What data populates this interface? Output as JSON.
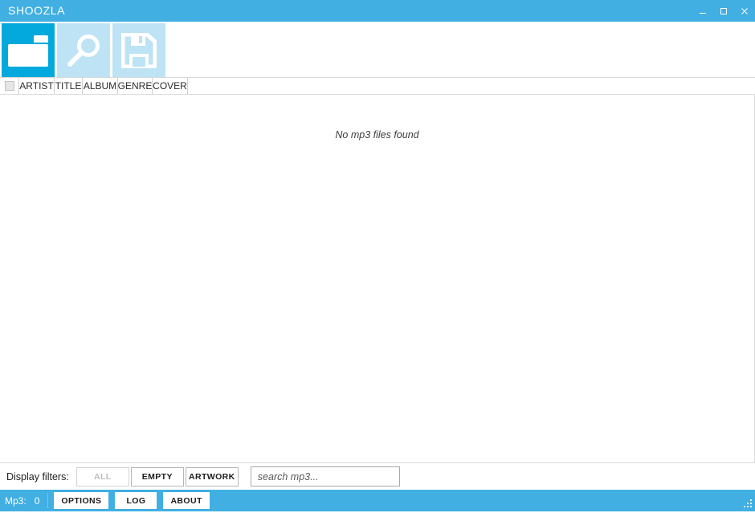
{
  "window": {
    "title": "SHOOZLA",
    "controls": {
      "minimize": "minimize",
      "maximize": "maximize",
      "close": "close"
    },
    "accent_color": "#41afe2",
    "toolbar_active_color": "#03a9dc",
    "toolbar_idle_color": "#bde3f5"
  },
  "toolbar": {
    "buttons": [
      {
        "name": "open-folder",
        "icon": "folder-icon",
        "state": "active"
      },
      {
        "name": "search",
        "icon": "magnifier-icon",
        "state": "idle"
      },
      {
        "name": "save",
        "icon": "floppy-disk-icon",
        "state": "idle"
      }
    ]
  },
  "list": {
    "select_all_checked": false,
    "columns": [
      "ARTIST",
      "TITLE",
      "ALBUM",
      "GENRE",
      "COVER"
    ],
    "rows": [],
    "empty_message": "No mp3 files found"
  },
  "filters": {
    "label": "Display filters:",
    "buttons": [
      {
        "label": "ALL",
        "disabled": true
      },
      {
        "label": "EMPTY",
        "disabled": false
      },
      {
        "label": "ARTWORK",
        "disabled": false
      }
    ],
    "search": {
      "value": "",
      "placeholder": "search mp3..."
    }
  },
  "status": {
    "count_label": "Mp3:",
    "count_value": "0",
    "buttons": [
      "OPTIONS",
      "LOG",
      "ABOUT"
    ]
  }
}
